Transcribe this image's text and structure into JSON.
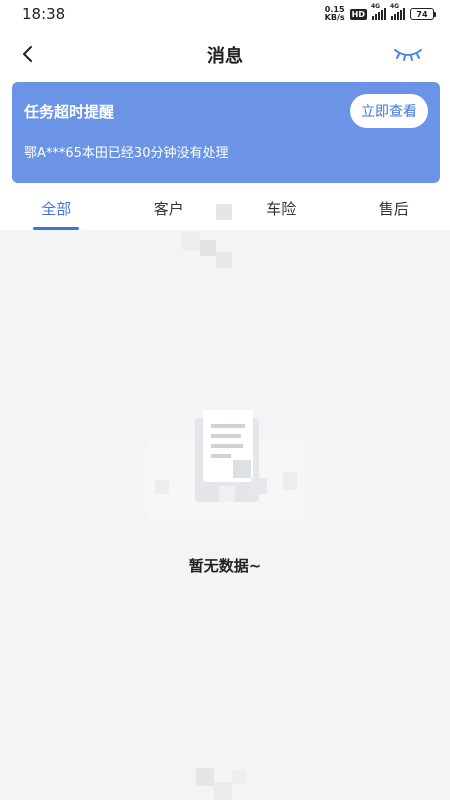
{
  "status_bar": {
    "time": "18:38",
    "speed_value": "0.15",
    "speed_unit": "KB/s",
    "hd_label": "HD",
    "network_1": "4G",
    "network_2": "4G",
    "battery": "74"
  },
  "nav": {
    "title": "消息",
    "back_icon": "chevron-left-icon",
    "eye_icon": "eye-closed-icon"
  },
  "alert": {
    "title": "任务超时提醒",
    "description": "鄂A***65本田已经30分钟没有处理",
    "button_label": "立即查看",
    "background_color": "#6b94e6"
  },
  "tabs": [
    {
      "label": "全部",
      "active": true
    },
    {
      "label": "客户",
      "active": false
    },
    {
      "label": "车险",
      "active": false
    },
    {
      "label": "售后",
      "active": false
    }
  ],
  "accent_color": "#3f74e0",
  "empty_state": {
    "text": "暂无数据~",
    "icon": "empty-document-icon"
  }
}
